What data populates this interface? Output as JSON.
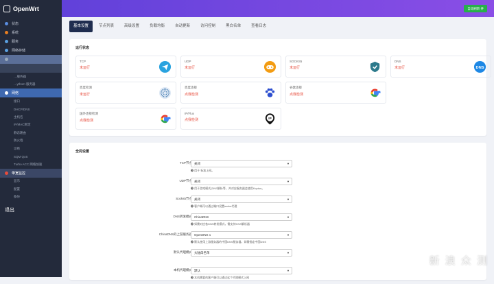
{
  "app": {
    "name": "OpenWrt",
    "auto_refresh": "自动刷新 开"
  },
  "sidebar": {
    "items": [
      {
        "label": "状态",
        "color": "#5a8de0",
        "type": "top"
      },
      {
        "label": "系统",
        "color": "#e67e22",
        "type": "top"
      },
      {
        "label": "服务",
        "color": "#5aa0e0",
        "type": "top"
      },
      {
        "label": "网络存储",
        "color": "#5aa0e0",
        "type": "top"
      },
      {
        "label": "",
        "color": "#9ab",
        "type": "hl"
      },
      {
        "label": "",
        "color": "",
        "type": "sel"
      },
      {
        "label": "…服务器",
        "color": "",
        "type": "sub"
      },
      {
        "label": "…ythom 服务器",
        "color": "",
        "type": "sub"
      },
      {
        "label": "网络",
        "color": "#ffffff",
        "type": "blue"
      },
      {
        "label": "接口",
        "type": "sub"
      },
      {
        "label": "DHCP/DNS",
        "type": "sub"
      },
      {
        "label": "主机名",
        "type": "sub"
      },
      {
        "label": "IP/MAC绑定",
        "type": "sub"
      },
      {
        "label": "静态路由",
        "type": "sub"
      },
      {
        "label": "防火墙",
        "type": "sub"
      },
      {
        "label": "诊断",
        "type": "sub"
      },
      {
        "label": "SQM QoS",
        "type": "sub"
      },
      {
        "label": "Turbo ACC 网络加速",
        "type": "sub"
      },
      {
        "label": "带宽监控",
        "color": "#e74c3c",
        "type": "red"
      },
      {
        "label": "显示",
        "type": "sub"
      },
      {
        "label": "配置",
        "type": "sub"
      },
      {
        "label": "备份",
        "type": "sub"
      }
    ],
    "logout": "退出"
  },
  "tabs": [
    "基本设置",
    "节点列表",
    "高级设置",
    "负载均衡",
    "自动更新",
    "访问控制",
    "黑白名单",
    "查看日志"
  ],
  "status": {
    "title": "运行状态",
    "cards": [
      {
        "name": "TCP",
        "state": "未运行",
        "icon": "telegram-icon",
        "color": "#2aa3df"
      },
      {
        "name": "UDP",
        "state": "未运行",
        "icon": "gamepad-icon",
        "color": "#f39c12"
      },
      {
        "name": "SOCKS5",
        "state": "未运行",
        "icon": "shield-icon",
        "color": "#2c7a8c"
      },
      {
        "name": "DNS",
        "state": "未运行",
        "icon": "dns-icon",
        "color": "#1e88e5"
      },
      {
        "name": "百度检测",
        "state": "未运行",
        "icon": "network-ball-icon",
        "color": "#1a5fa0"
      },
      {
        "name": "百度连接",
        "state": "点我检测",
        "icon": "paw-icon",
        "color": "#2d4fcf"
      },
      {
        "name": "谷歌连接",
        "state": "点我检测",
        "icon": "google-icon",
        "color": "#4285f4"
      },
      {
        "name": "",
        "state": "",
        "icon": "",
        "color": ""
      },
      {
        "name": "国外连接检测",
        "state": "点我检测",
        "icon": "google-icon",
        "color": "#4285f4"
      },
      {
        "name": "IP/Flux",
        "state": "点我检测",
        "icon": "ip-pin-icon",
        "color": "#111"
      }
    ]
  },
  "global": {
    "title": "全局设置",
    "fields": [
      {
        "label": "TCP节点",
        "value": "关闭",
        "help": "❷ 用于 标准上网。"
      },
      {
        "label": "UDP节点",
        "value": "关闭",
        "help": "❷ 用于游戏模式(DNS解析等，并对应服务器会使用Kcptun。"
      },
      {
        "label": "Socks5节点",
        "value": "关闭",
        "help": "❷ 客户端可以通过端口设置socks代理"
      },
      {
        "label": "DNS转发模式",
        "value": "ChinaDNS",
        "help": "❷ 如需对应各DNS转发模式，需支持DNS解析器"
      },
      {
        "label": "ChinaDNS的上游服务器",
        "value": "OpenDNS 1",
        "help": "❷ 默认使用上游服务器的中国DNS服务器，如需指定中国DNS"
      },
      {
        "label": "默认代理模式",
        "value": "大陆白名单",
        "help": ""
      },
      {
        "label": "本机代理模式",
        "value": "默认",
        "help": "❷ 本机需要的客户端可以通过这个代理模式上网"
      }
    ]
  },
  "watermark": "新 浪 众 测"
}
